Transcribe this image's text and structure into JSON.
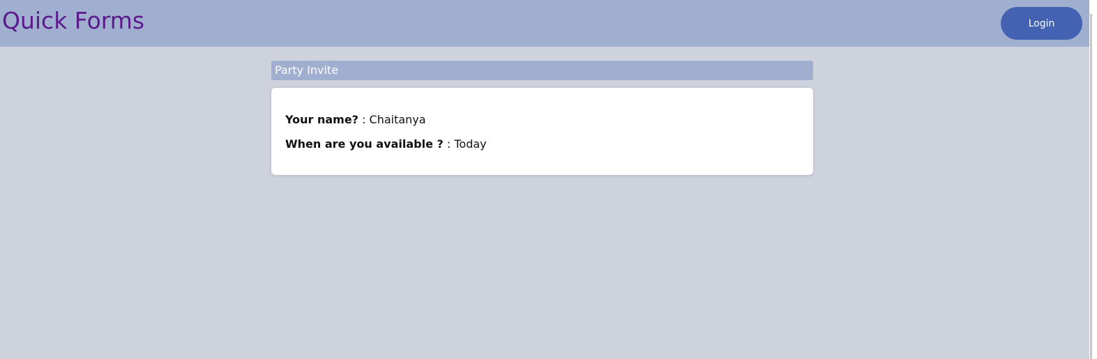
{
  "navbar": {
    "brand": "Quick Forms",
    "login_label": "Login"
  },
  "form": {
    "title": "Party Invite",
    "fields": [
      {
        "label": "Your name?",
        "separator": " : ",
        "value": "Chaitanya"
      },
      {
        "label": "When are you available ?",
        "separator": " : ",
        "value": "Today"
      }
    ]
  },
  "colors": {
    "page_bg": "#ced2dd",
    "navbar_bg": "#a0afd0",
    "brand_text": "#5b1a8b",
    "login_bg": "#4363b2"
  }
}
